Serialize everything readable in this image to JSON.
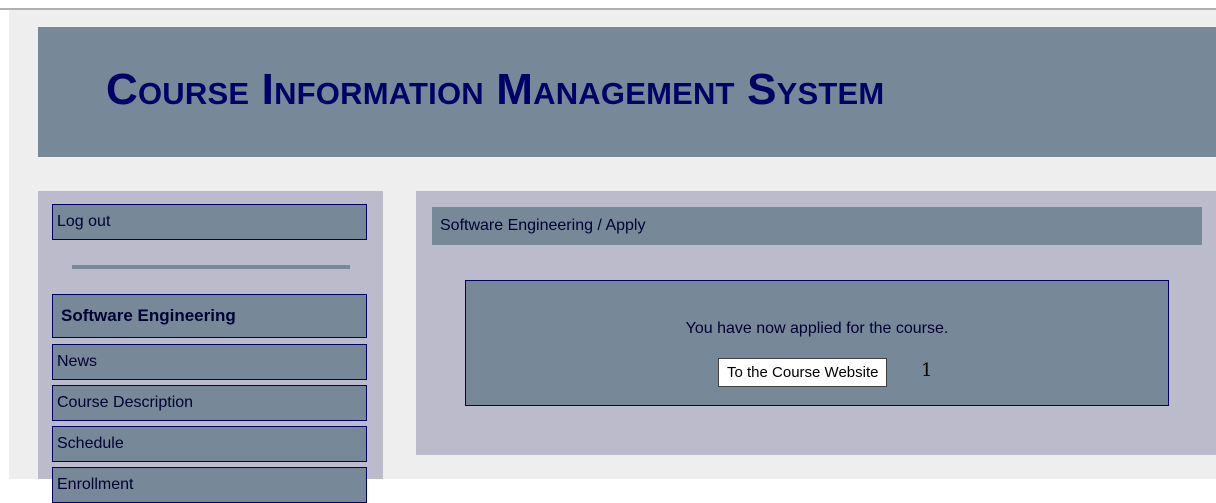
{
  "header": {
    "title": "Course Information Management System"
  },
  "sidebar": {
    "logout_label": "Log out",
    "course_title": "Software Engineering",
    "items": [
      {
        "label": "News"
      },
      {
        "label": "Course Description"
      },
      {
        "label": "Schedule"
      },
      {
        "label": "Enrollment"
      }
    ]
  },
  "main": {
    "breadcrumb": "Software Engineering / Apply",
    "message": "You have now applied for the course.",
    "website_button_label": "To the Course Website",
    "marker": "1"
  },
  "colors": {
    "banner": "#778899",
    "panel": "#bbbbcc",
    "title_text": "#000066",
    "page_background": "#eeeeee"
  }
}
